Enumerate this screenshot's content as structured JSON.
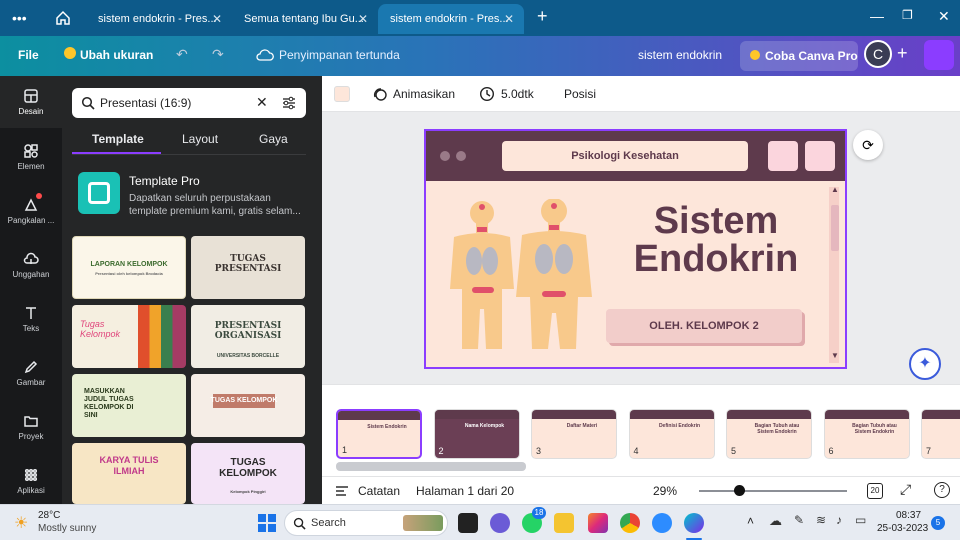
{
  "browser": {
    "tabs": [
      {
        "label": "sistem endokrin - Pres...",
        "active": false
      },
      {
        "label": "Semua tentang Ibu Gu...",
        "active": false
      },
      {
        "label": "sistem endokrin - Pres...",
        "active": true
      }
    ],
    "new_tab": "+"
  },
  "header": {
    "file": "File",
    "resize": "Ubah ukuran",
    "save_status": "Penyimpanan tertunda",
    "doc_title": "sistem endokrin",
    "try_pro": "Coba Canva Pro",
    "avatar_letter": "C",
    "add": "+"
  },
  "rail": [
    {
      "label": "Desain",
      "icon": "layout-icon"
    },
    {
      "label": "Elemen",
      "icon": "shapes-icon"
    },
    {
      "label": "Pangkalan ...",
      "icon": "brand-kit-icon"
    },
    {
      "label": "Unggahan",
      "icon": "upload-cloud-icon"
    },
    {
      "label": "Teks",
      "icon": "text-t-icon"
    },
    {
      "label": "Gambar",
      "icon": "draw-pen-icon"
    },
    {
      "label": "Proyek",
      "icon": "folder-icon"
    },
    {
      "label": "Aplikasi",
      "icon": "apps-grid-icon"
    }
  ],
  "panel": {
    "search_value": "Presentasi (16:9)",
    "tabs": [
      "Template",
      "Layout",
      "Gaya"
    ],
    "pro_title": "Template Pro",
    "pro_desc": "Dapatkan seluruh perpustakaan template premium kami, gratis selam...",
    "thumbs": [
      {
        "title": "LAPORAN KELOMPOK",
        "sub": "Presentasi oleh kelompok Brodacia"
      },
      {
        "title": "TUGAS PRESENTASI",
        "sub": ""
      },
      {
        "title": "Tugas Kelompok",
        "sub": ""
      },
      {
        "title": "PRESENTASI ORGANISASI",
        "sub": "UNIVERSITAS BORCELLE"
      },
      {
        "title": "MASUKKAN JUDUL TUGAS KELOMPOK DI SINI",
        "sub": ""
      },
      {
        "title": "TUGAS KELOMPOK",
        "sub": ""
      },
      {
        "title": "KARYA TULIS ILMIAH",
        "sub": ""
      },
      {
        "title": "TUGAS KELOMPOK",
        "sub": "Kelompok Pinggiri"
      }
    ]
  },
  "toolbar": {
    "animate": "Animasikan",
    "duration": "5.0dtk",
    "position": "Posisi"
  },
  "slide": {
    "header_label": "Psikologi Kesehatan",
    "title_line1": "Sistem",
    "title_line2": "Endokrin",
    "byline": "OLEH. KELOMPOK 2"
  },
  "pages": [
    {
      "num": "1",
      "title": "Sistem Endokrin"
    },
    {
      "num": "2",
      "title": "Nama Kelompok"
    },
    {
      "num": "3",
      "title": "Daftar Materi"
    },
    {
      "num": "4",
      "title": "Definisi Endokrin"
    },
    {
      "num": "5",
      "title": "Bagian Tubuh atau Sistem Endokrin"
    },
    {
      "num": "6",
      "title": "Bagian Tubuh atau Sistem Endokrin"
    },
    {
      "num": "7",
      "title": ""
    }
  ],
  "footer": {
    "notes": "Catatan",
    "page_info": "Halaman 1 dari 20",
    "zoom": "29%",
    "page_count": "20",
    "help": "?"
  },
  "taskbar": {
    "temp": "28°C",
    "weather": "Mostly sunny",
    "search": "Search",
    "time": "08:37",
    "date": "25-03-2023",
    "notif": "5",
    "whatsapp_badge": "18"
  },
  "colors": {
    "accent": "#8b3dff",
    "slide_bg": "#fde6da",
    "slide_header": "#5e3a4c",
    "title": "#5e3a4c"
  }
}
